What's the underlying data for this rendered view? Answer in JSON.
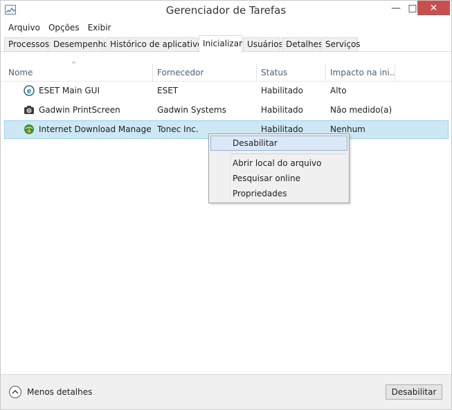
{
  "window": {
    "title": "Gerenciador de Tarefas",
    "controls": {
      "minimize": "—",
      "maximize": "□",
      "close": "✕"
    }
  },
  "menubar": [
    "Arquivo",
    "Opções",
    "Exibir"
  ],
  "tabs": [
    {
      "label": "Processos",
      "active": false
    },
    {
      "label": "Desempenho",
      "active": false
    },
    {
      "label": "Histórico de aplicativos",
      "active": false
    },
    {
      "label": "Inicializar",
      "active": true
    },
    {
      "label": "Usuários",
      "active": false
    },
    {
      "label": "Detalhes",
      "active": false
    },
    {
      "label": "Serviços",
      "active": false
    }
  ],
  "table": {
    "columns": [
      "Nome",
      "Fornecedor",
      "Status",
      "Impacto na ini..."
    ],
    "sort_indicator": "^",
    "rows": [
      {
        "name": "ESET Main GUI",
        "vendor": "ESET",
        "status": "Habilitado",
        "impact": "Alto",
        "icon": "eset-icon",
        "selected": false
      },
      {
        "name": "Gadwin PrintScreen",
        "vendor": "Gadwin Systems",
        "status": "Habilitado",
        "impact": "Não medido(a)",
        "icon": "camera-icon",
        "selected": false
      },
      {
        "name": "Internet Download Manager...",
        "vendor": "Tonec Inc.",
        "status": "Habilitado",
        "impact": "Nenhum",
        "icon": "idm-globe-icon",
        "selected": true
      }
    ]
  },
  "context_menu": {
    "items": [
      "Desabilitar",
      "Abrir local do arquivo",
      "Pesquisar online",
      "Propriedades"
    ],
    "hovered": "Desabilitar"
  },
  "footer": {
    "less_details": "Menos detalhes",
    "disable_button": "Desabilitar"
  },
  "colors": {
    "selection_bg": "#cce8f4",
    "selection_border": "#99d1ea",
    "close_button": "#c7504f",
    "header_text": "#4c607a"
  }
}
